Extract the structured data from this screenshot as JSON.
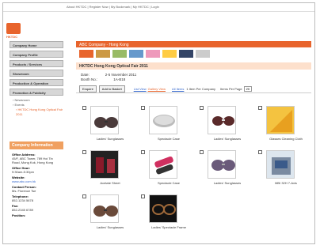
{
  "toplinks": "About HKTDC | Register Now | My Bookmark | My HKTDC | Login",
  "logo": "HKTDC",
  "sidebar": {
    "items": [
      {
        "label": "Company Home"
      },
      {
        "label": "Company Profile"
      },
      {
        "label": "Products / Services"
      },
      {
        "label": "Showroom"
      },
      {
        "label": "Production & Operation"
      },
      {
        "label": "Promotion & Publicity"
      }
    ],
    "sub": [
      "Newsroom",
      "Events",
      "HKTDC Hong Kong Optical Fair 2011"
    ]
  },
  "company_info": {
    "title": "Company Information",
    "office_label": "Office Address:",
    "office": "45/F, ABC Tower, 789 Hoi Tin Road, Mong Kok, Hong Kong",
    "hours_label": "Office Hour:",
    "hours": "9:30am-5:30pm",
    "web_label": "Website:",
    "web": "www.abc.com.hk",
    "contact_label": "Contact Person:",
    "contact": "Ms. Florence Tse",
    "tel_label": "Telephone:",
    "tel": "852-1234 5678",
    "fax_label": "Fax:",
    "fax": "852-2345 6789",
    "position_label": "Position:"
  },
  "main": {
    "title": "ABC Company - Hong Kong",
    "fair": "HKTDC Hong Kong Optical Fair 2011",
    "date_label": "Date:",
    "date_value": "2-5 November 2011",
    "booth_label": "Booth No.:",
    "booth_value": "1A-B18",
    "toolbar": {
      "enquire": "Enquire",
      "add": "Add to Basket",
      "list_view": "List View",
      "gallery_view": "Gallery View",
      "all_items": "All Items",
      "items_count": "1 Item Per Company",
      "per_page_label": "Items Per Page",
      "per_page_value": "20"
    },
    "products": [
      {
        "label": "Ladies' Sunglasses"
      },
      {
        "label": "Spectacle Case"
      },
      {
        "label": "Ladies' Sunglasses"
      },
      {
        "label": "Glasses Cleaning Cloth"
      },
      {
        "label": "Acetate Sheet"
      },
      {
        "label": "Spectacle Case"
      },
      {
        "label": "Ladies' Sunglasses"
      },
      {
        "label": "MBI 32H 7-Axis"
      },
      {
        "label": "Ladies' Sunglasses"
      },
      {
        "label": "Ladies' Spectacle Frame"
      }
    ]
  },
  "colors": {
    "accent": "#e8642c"
  }
}
